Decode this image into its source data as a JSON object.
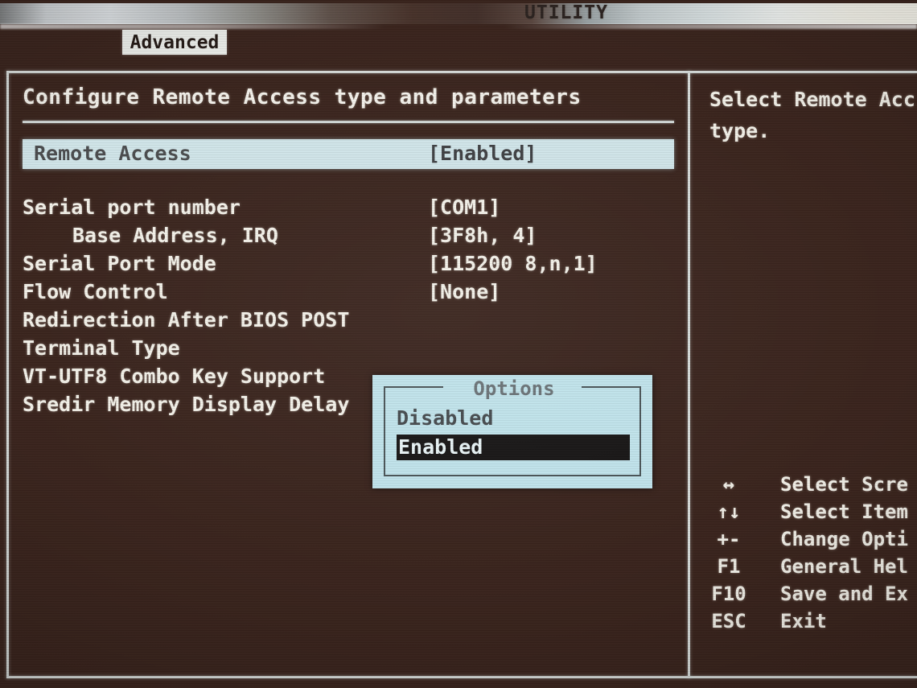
{
  "header": {
    "utility_title": "UTILITY",
    "tab_label": "Advanced"
  },
  "main": {
    "pane_title": "Configure Remote Access type and parameters",
    "selected_row": {
      "label": "Remote Access",
      "value": "[Enabled]"
    },
    "settings": [
      {
        "label": "Serial port number",
        "value": "[COM1]",
        "indent": false
      },
      {
        "label": "Base Address, IRQ",
        "value": "[3F8h, 4]",
        "indent": true
      },
      {
        "label": "Serial Port Mode",
        "value": "[115200 8,n,1]",
        "indent": false
      },
      {
        "label": "Flow Control",
        "value": "[None]",
        "indent": false
      },
      {
        "label": "Redirection After BIOS POST",
        "value": "",
        "indent": false
      },
      {
        "label": "Terminal Type",
        "value": "",
        "indent": false
      },
      {
        "label": "VT-UTF8 Combo Key Support",
        "value": "",
        "indent": false
      },
      {
        "label": "Sredir Memory Display Delay",
        "value": "",
        "indent": false
      }
    ]
  },
  "popup": {
    "title": "Options",
    "items": [
      {
        "label": "Disabled",
        "selected": false
      },
      {
        "label": "Enabled",
        "selected": true
      }
    ]
  },
  "help": {
    "lines": [
      "Select Remote Acc",
      "type."
    ]
  },
  "keys": [
    {
      "key": "↔",
      "desc": "Select Scre"
    },
    {
      "key": "↑↓",
      "desc": "Select Item"
    },
    {
      "key": "+-",
      "desc": "Change Opti"
    },
    {
      "key": "F1",
      "desc": "General Hel"
    },
    {
      "key": "F10",
      "desc": "Save and Ex"
    },
    {
      "key": "ESC",
      "desc": "Exit"
    }
  ],
  "colors": {
    "screen_bg": "#3a241d",
    "text": "#f2f0e8",
    "highlight_bg": "#cfe4e8",
    "popup_bg": "#bfe2ea",
    "popup_selected_bg": "#171515"
  }
}
